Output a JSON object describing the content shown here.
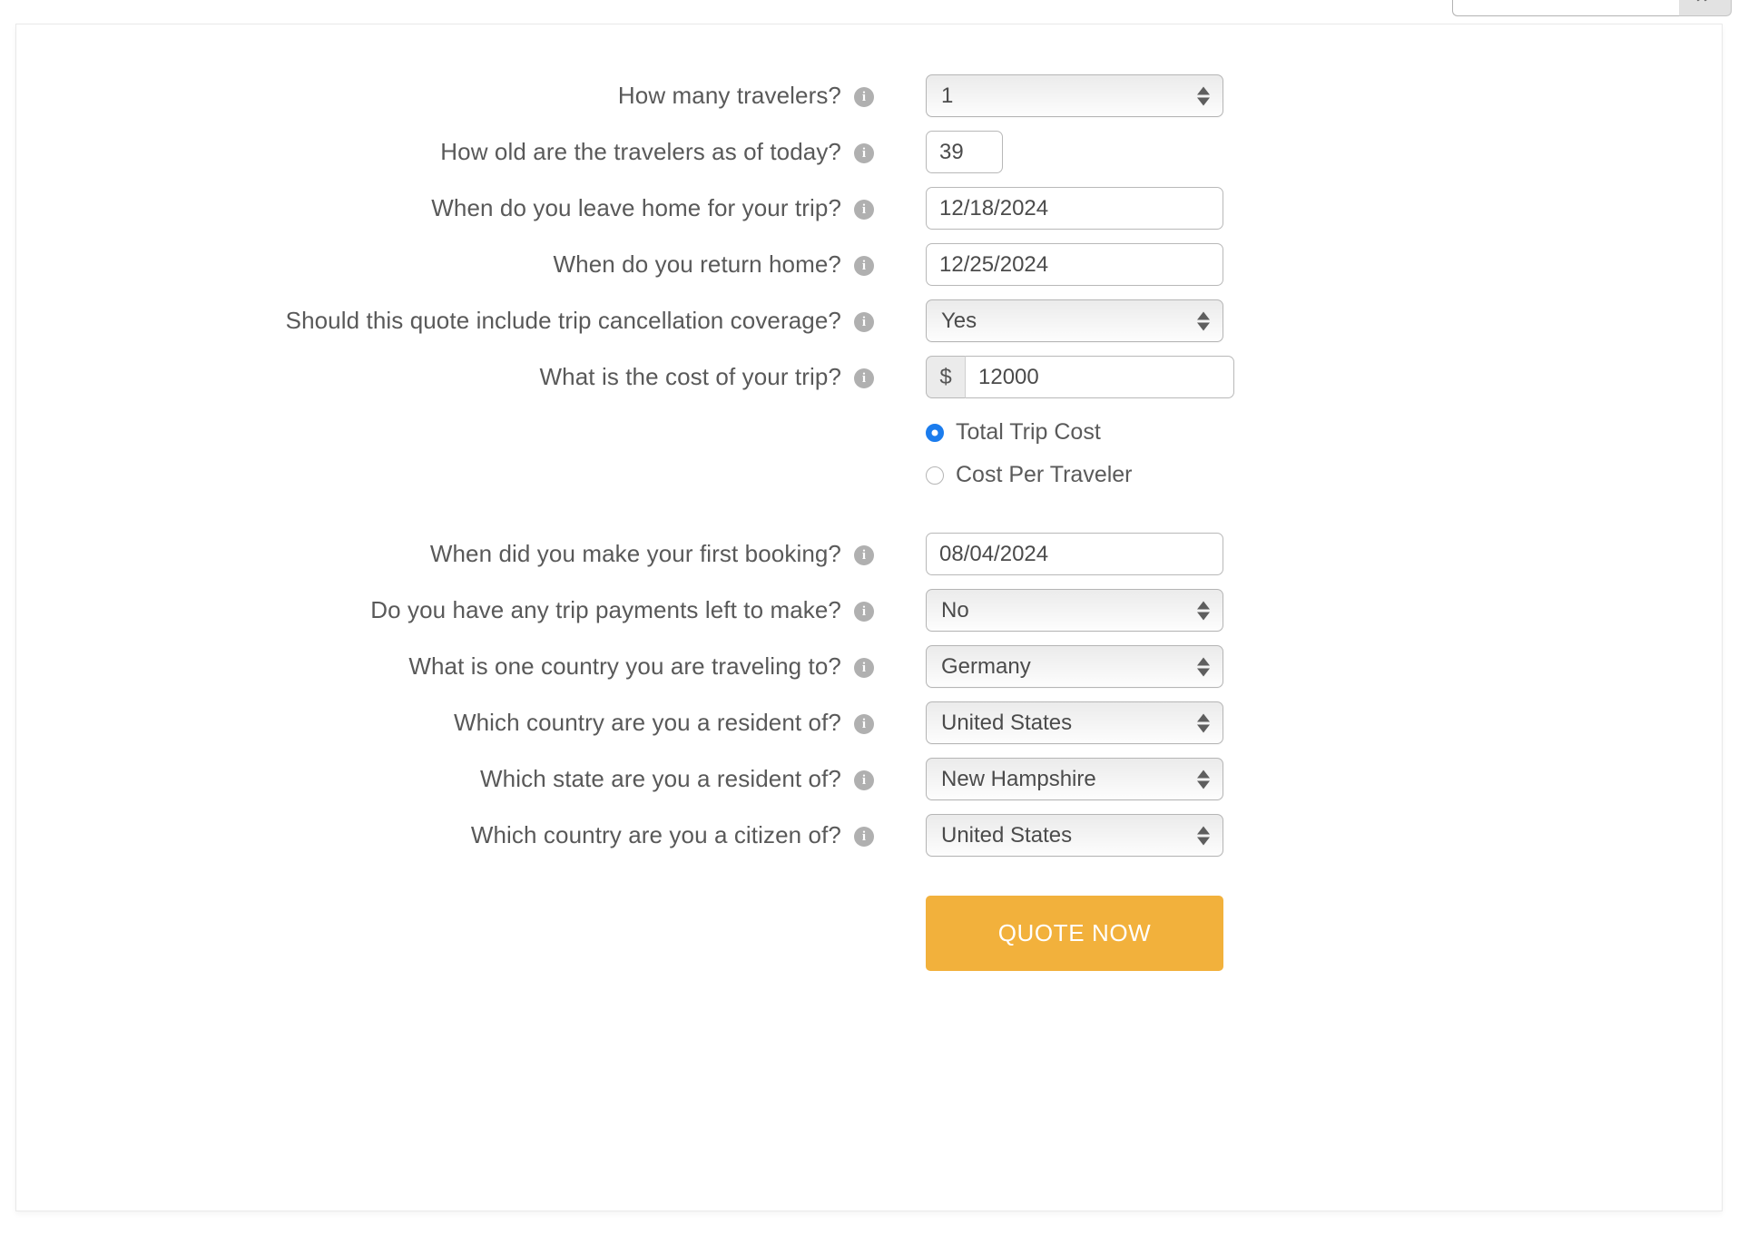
{
  "top_bar": {
    "search_placeholder": "",
    "search_value": "",
    "search_button_icon": "chevron-double-right-icon"
  },
  "form": {
    "rows": [
      {
        "id": "travelers",
        "label": "How many travelers?",
        "info_icon": "info-icon",
        "control": "select",
        "value": "1"
      },
      {
        "id": "ages",
        "label": "How old are the travelers as of today?",
        "info_icon": "info-icon",
        "control": "text-narrow",
        "value": "39"
      },
      {
        "id": "depart-date",
        "label": "When do you leave home for your trip?",
        "info_icon": "info-icon",
        "control": "text-wide",
        "value": "12/18/2024"
      },
      {
        "id": "return-date",
        "label": "When do you return home?",
        "info_icon": "info-icon",
        "control": "text-wide",
        "value": "12/25/2024"
      },
      {
        "id": "cancellation-coverage",
        "label": "Should this quote include trip cancellation coverage?",
        "info_icon": "info-icon",
        "control": "select",
        "value": "Yes"
      },
      {
        "id": "trip-cost",
        "label": "What is the cost of your trip?",
        "info_icon": "info-icon",
        "control": "money",
        "addon": "$",
        "value": "12000"
      },
      {
        "id": "first-booking-date",
        "label": "When did you make your first booking?",
        "info_icon": "info-icon",
        "control": "text-wide",
        "value": "08/04/2024"
      },
      {
        "id": "payments-left",
        "label": "Do you have any trip payments left to make?",
        "info_icon": "info-icon",
        "control": "select",
        "value": "No"
      },
      {
        "id": "destination-country",
        "label": "What is one country you are traveling to?",
        "info_icon": "info-icon",
        "control": "select",
        "value": "Germany"
      },
      {
        "id": "residence-country",
        "label": "Which country are you a resident of?",
        "info_icon": "info-icon",
        "control": "select",
        "value": "United States"
      },
      {
        "id": "residence-state",
        "label": "Which state are you a resident of?",
        "info_icon": "info-icon",
        "control": "select",
        "value": "New Hampshire"
      },
      {
        "id": "citizenship-country",
        "label": "Which country are you a citizen of?",
        "info_icon": "info-icon",
        "control": "select",
        "value": "United States"
      }
    ],
    "cost_basis": {
      "options": [
        {
          "label": "Total Trip Cost",
          "selected": true
        },
        {
          "label": "Cost Per Traveler",
          "selected": false
        }
      ],
      "selected_color": "#1b7ced"
    },
    "submit": {
      "label": "QUOTE NOW",
      "color": "#f2b13c"
    }
  }
}
